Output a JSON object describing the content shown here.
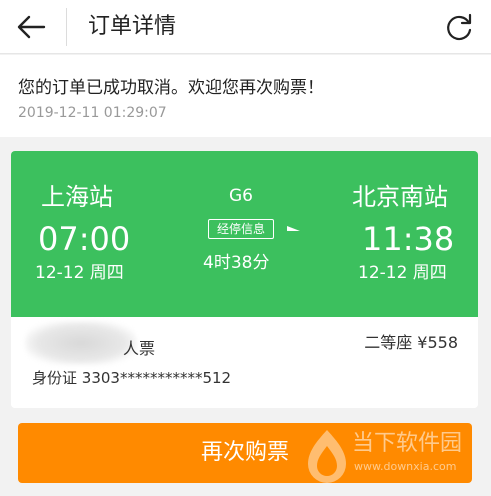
{
  "header": {
    "title": "订单详情",
    "back_icon": "back-arrow-icon",
    "refresh_icon": "refresh-icon"
  },
  "notice": {
    "message": "您的订单已成功取消。欢迎您再次购票！",
    "timestamp": "2019-12-11 01:29:07"
  },
  "ticket": {
    "from_station": "上海站",
    "to_station": "北京南站",
    "departure_time": "07:00",
    "arrival_time": "11:38",
    "departure_date": "12-12 周四",
    "arrival_date": "12-12 周四",
    "train_number": "G6",
    "stops_label": "经停信息",
    "duration": "4时38分",
    "passenger_type": "人票",
    "seat_price": "二等座 ¥558",
    "id_label": "身份证",
    "id_number": "3303***********512"
  },
  "actions": {
    "rebuy_label": "再次购票"
  },
  "watermark": {
    "name": "当下软件园",
    "url": "www.downxia.com"
  },
  "colors": {
    "card_green": "#3cc05e",
    "button_orange": "#ff8a00",
    "background": "#f2f2f2"
  }
}
